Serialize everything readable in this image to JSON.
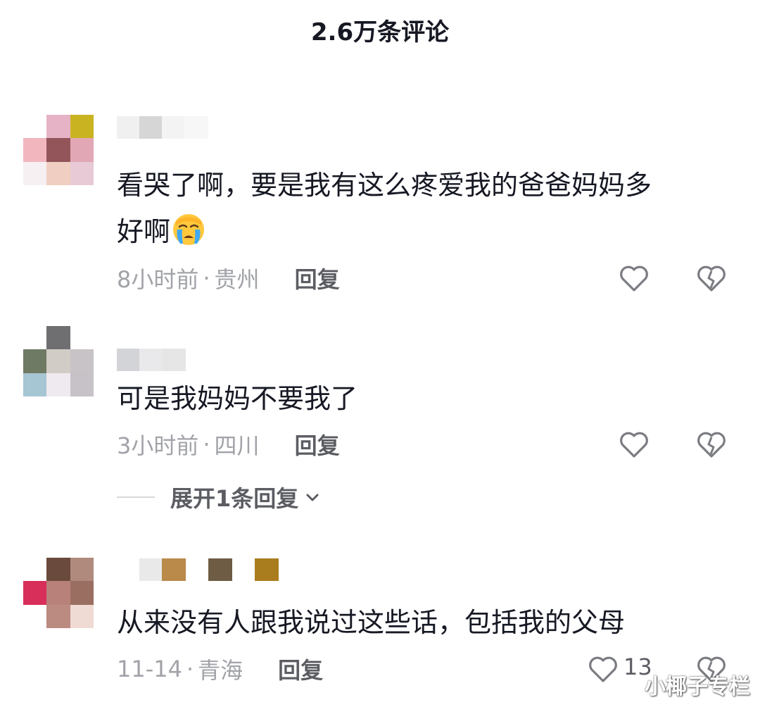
{
  "header": {
    "title": "2.6万条评论"
  },
  "comments": [
    {
      "text_line1": "看哭了啊，要是我有这么疼爱我的爸爸妈妈多",
      "text_line2": "好啊",
      "emoji": "crying-face-icon",
      "time": "8小时前",
      "location": "贵州",
      "reply_label": "回复",
      "like_count": ""
    },
    {
      "text_line1": "可是我妈妈不要我了",
      "time": "3小时前",
      "location": "四川",
      "reply_label": "回复",
      "like_count": "",
      "expand_label": "展开1条回复"
    },
    {
      "text_line1": "从来没有人跟我说过这些话，包括我的父母",
      "time": "11-14",
      "location": "青海",
      "reply_label": "回复",
      "like_count": "13"
    }
  ],
  "separator": "·",
  "watermark": "小椰子专栏",
  "colors": {
    "text": "#161823",
    "meta": "#a1a3a8",
    "reply": "#5b5d63",
    "icon": "#7a7c82"
  }
}
